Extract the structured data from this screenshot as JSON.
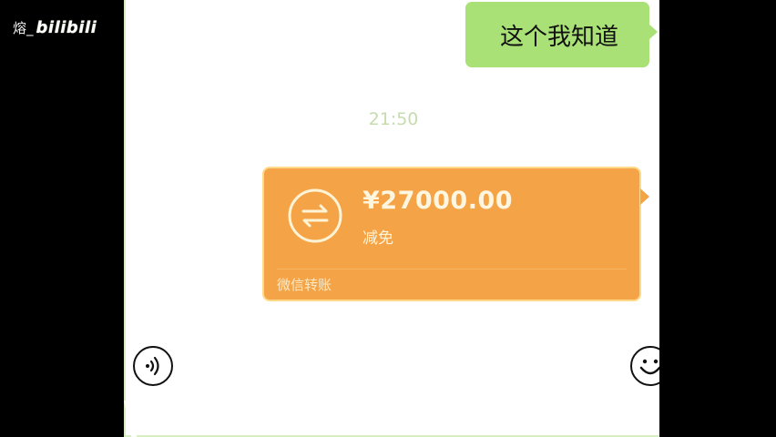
{
  "watermark": {
    "user": "熔_",
    "brand": "bilibili"
  },
  "chat": {
    "outgoing_message": "这个我知道",
    "timestamp": "21:50",
    "transfer": {
      "amount": "¥27000.00",
      "status": "减免",
      "footer": "微信转账",
      "icon": "transfer-arrows-icon",
      "color": "#f4a447"
    }
  },
  "input_bar": {
    "left_icon": "voice-icon",
    "right_icon": "emoji-icon"
  },
  "colors": {
    "outgoing_bubble": "#a9e177",
    "transfer_bubble": "#f4a447",
    "background": "#000000"
  }
}
